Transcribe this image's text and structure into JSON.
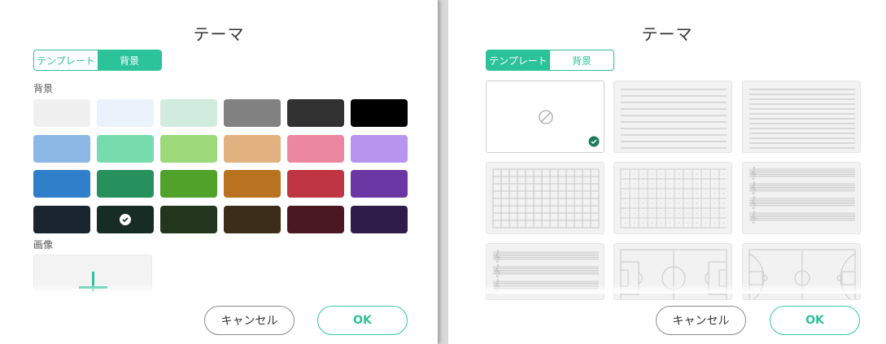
{
  "left": {
    "title": "テーマ",
    "tabs": [
      {
        "label": "テンプレート",
        "active": false
      },
      {
        "label": "背景",
        "active": true
      }
    ],
    "background_label": "背景",
    "colors": [
      [
        "#f0f0f0",
        "#eaf3fb",
        "#d1ebdf",
        "#828282",
        "#313131",
        "#000000"
      ],
      [
        "#8db8e5",
        "#76dbad",
        "#9bd979",
        "#e1b17f",
        "#ec87a1",
        "#b795ee"
      ],
      [
        "#2f7fca",
        "#27915d",
        "#50a22b",
        "#b9721f",
        "#c03544",
        "#6a37a4"
      ],
      [
        "#1b2530",
        "#162c24",
        "#21361d",
        "#3c2c1a",
        "#491822",
        "#2f1c4b"
      ]
    ],
    "selected_color": "#162c24",
    "image_label": "画像",
    "add_icon": "plus-icon",
    "cancel_label": "キャンセル",
    "ok_label": "OK",
    "accent_color": "#2cc29a"
  },
  "right": {
    "title": "テーマ",
    "tabs": [
      {
        "label": "テンプレート",
        "active": true
      },
      {
        "label": "背景",
        "active": false
      }
    ],
    "templates": [
      "none",
      "ruled",
      "ruled-narrow",
      "grid",
      "dot-grid",
      "staff",
      "staff-single",
      "soccer-field",
      "basketball-court"
    ],
    "selected_template": "none",
    "none_icon": "prohibited-icon",
    "cancel_label": "キャンセル",
    "ok_label": "OK"
  }
}
